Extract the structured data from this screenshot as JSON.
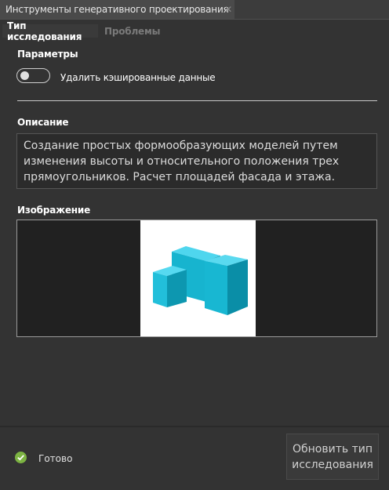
{
  "window": {
    "tab_title": "Инструменты генеративного проектирования",
    "close_glyph": "✕"
  },
  "tabs": [
    {
      "label": "Тип исследования",
      "active": true
    },
    {
      "label": "Проблемы",
      "active": false
    }
  ],
  "parameters": {
    "heading": "Параметры",
    "toggle": {
      "label": "Удалить кэшированные данные",
      "on": false
    }
  },
  "description": {
    "heading": "Описание",
    "text": "Создание простых формообразующих моделей путем изменения высоты и относительного положения трех прямоугольников. Расчет площадей фасада и этажа."
  },
  "image": {
    "heading": "Изображение",
    "block_color": "#1ab5d0"
  },
  "status": {
    "icon": "check-circle-icon",
    "text": "Готово",
    "color": "#7cb342"
  },
  "action": {
    "label": "Обновить тип исследования"
  }
}
